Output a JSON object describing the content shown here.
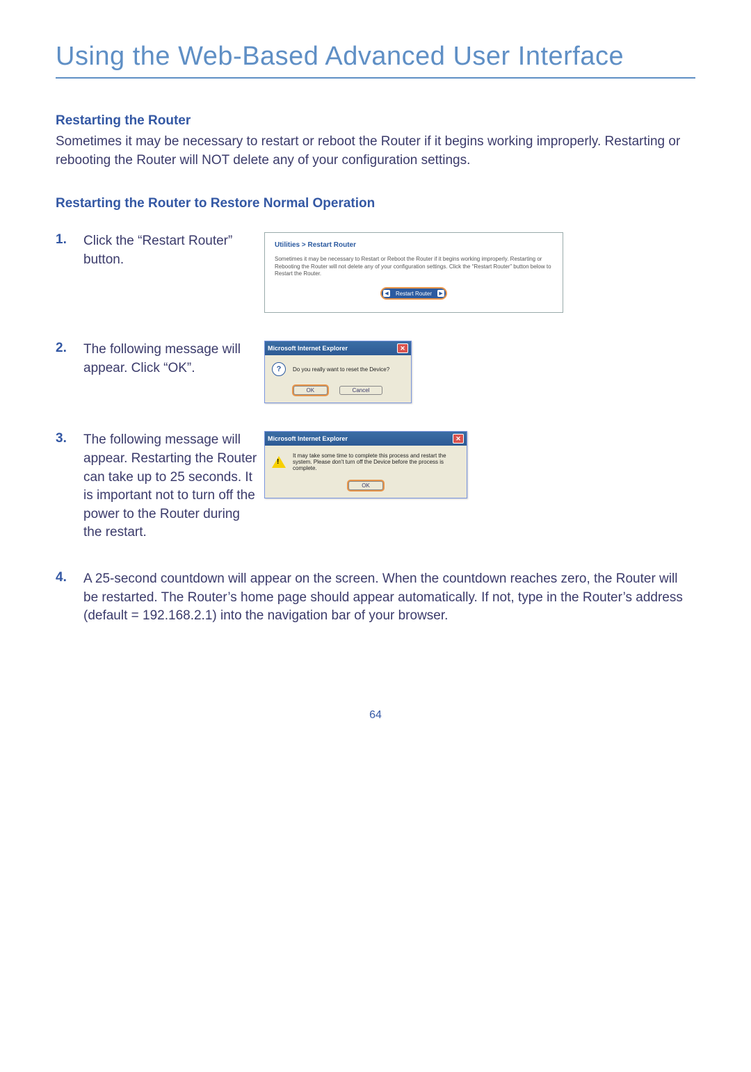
{
  "page_title": "Using the Web-Based Advanced User Interface",
  "section_heading": "Restarting the Router",
  "intro_text": "Sometimes it may be necessary to restart or reboot the Router if it begins working improperly. Restarting or rebooting the Router will NOT delete any of your configuration settings.",
  "sub_heading": "Restarting the Router to Restore Normal Operation",
  "steps": {
    "s1": {
      "num": "1.",
      "text": "Click the “Restart Router” button."
    },
    "s2": {
      "num": "2.",
      "text": "The following message will appear. Click “OK”."
    },
    "s3": {
      "num": "3.",
      "text": "The following message will appear. Restarting the Router can take up to 25 seconds. It is important not to turn off the power to the Router during the restart."
    },
    "s4": {
      "num": "4.",
      "text": "A 25-second countdown will appear on the screen. When the countdown reaches zero, the Router will be restarted. The Router’s home page should appear automatically. If not, type in the Router’s address (default = 192.168.2.1) into the navigation bar of your browser."
    }
  },
  "utility": {
    "title": "Utilities > Restart Router",
    "desc": "Sometimes it may be necessary to Restart or Reboot the Router if it begins working improperly. Restarting or Rebooting the Router will not delete any of your configuration settings. Click the “Restart Router” button below to Restart the Router.",
    "button": "Restart Router"
  },
  "dialog1": {
    "title": "Microsoft Internet Explorer",
    "message": "Do you really want to reset the Device?",
    "ok": "OK",
    "cancel": "Cancel"
  },
  "dialog2": {
    "title": "Microsoft Internet Explorer",
    "message": "It may take some time to complete this process and restart the system. Please don't turn off the Device before the process is complete.",
    "ok": "OK"
  },
  "page_number": "64"
}
